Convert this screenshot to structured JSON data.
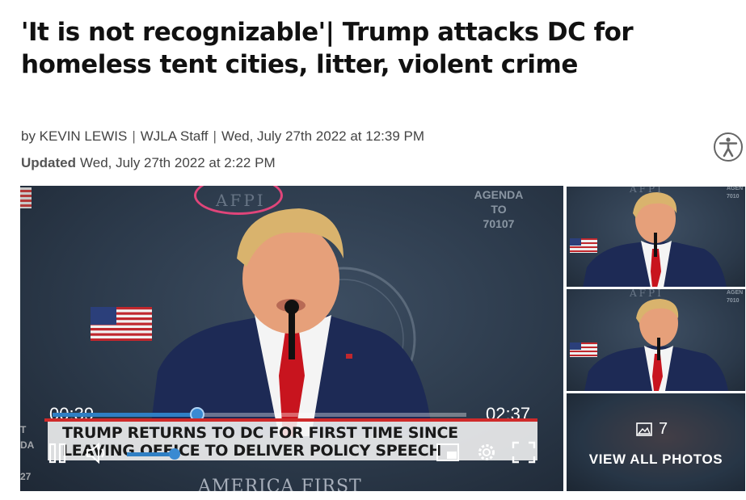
{
  "article": {
    "headline": "'It is not recognizable'| Trump attacks DC for homeless tent cities, litter, violent crime",
    "byline": {
      "by": "by KEVIN LEWIS",
      "sep1": "|",
      "org": "WJLA Staff",
      "sep2": "|",
      "published": "Wed, July 27th 2022 at 12:39 PM"
    },
    "updated_label": "Updated",
    "updated_time": "Wed, July 27th 2022 at 2:22 PM"
  },
  "accessibility": {
    "icon": "accessibility-person-icon"
  },
  "video": {
    "backdrop_text_top": "AFPI",
    "agenda_lines": [
      "AGENDA",
      "TO",
      "70107"
    ],
    "arc_text": "AMERICA FIRST",
    "bottom_text": "AMERICA FIRST",
    "current_time": "00:39",
    "duration": "02:37",
    "progress": 0.35,
    "volume": 0.95,
    "lower_third_line1": "TRUMP RETURNS TO DC FOR FIRST TIME SINCE",
    "lower_third_line2": "LEAVING OFFICE TO DELIVER POLICY SPEECH",
    "left_edge_text": [
      "T",
      "DA",
      "27"
    ],
    "controls": [
      "pause-icon",
      "volume-icon",
      "pip-icon",
      "settings-gear-icon",
      "fullscreen-icon"
    ],
    "colors": {
      "accent": "#2f7fc4",
      "lower_third_bar": "#cf2a2a",
      "highlight_circle": "#e0457a"
    }
  },
  "gallery": {
    "thumb_top_text": "AFPI",
    "thumb_agenda": [
      "AGEN",
      "7010"
    ],
    "photo_count": "7",
    "photo_icon": "image-icon",
    "view_all_label": "VIEW ALL PHOTOS"
  }
}
